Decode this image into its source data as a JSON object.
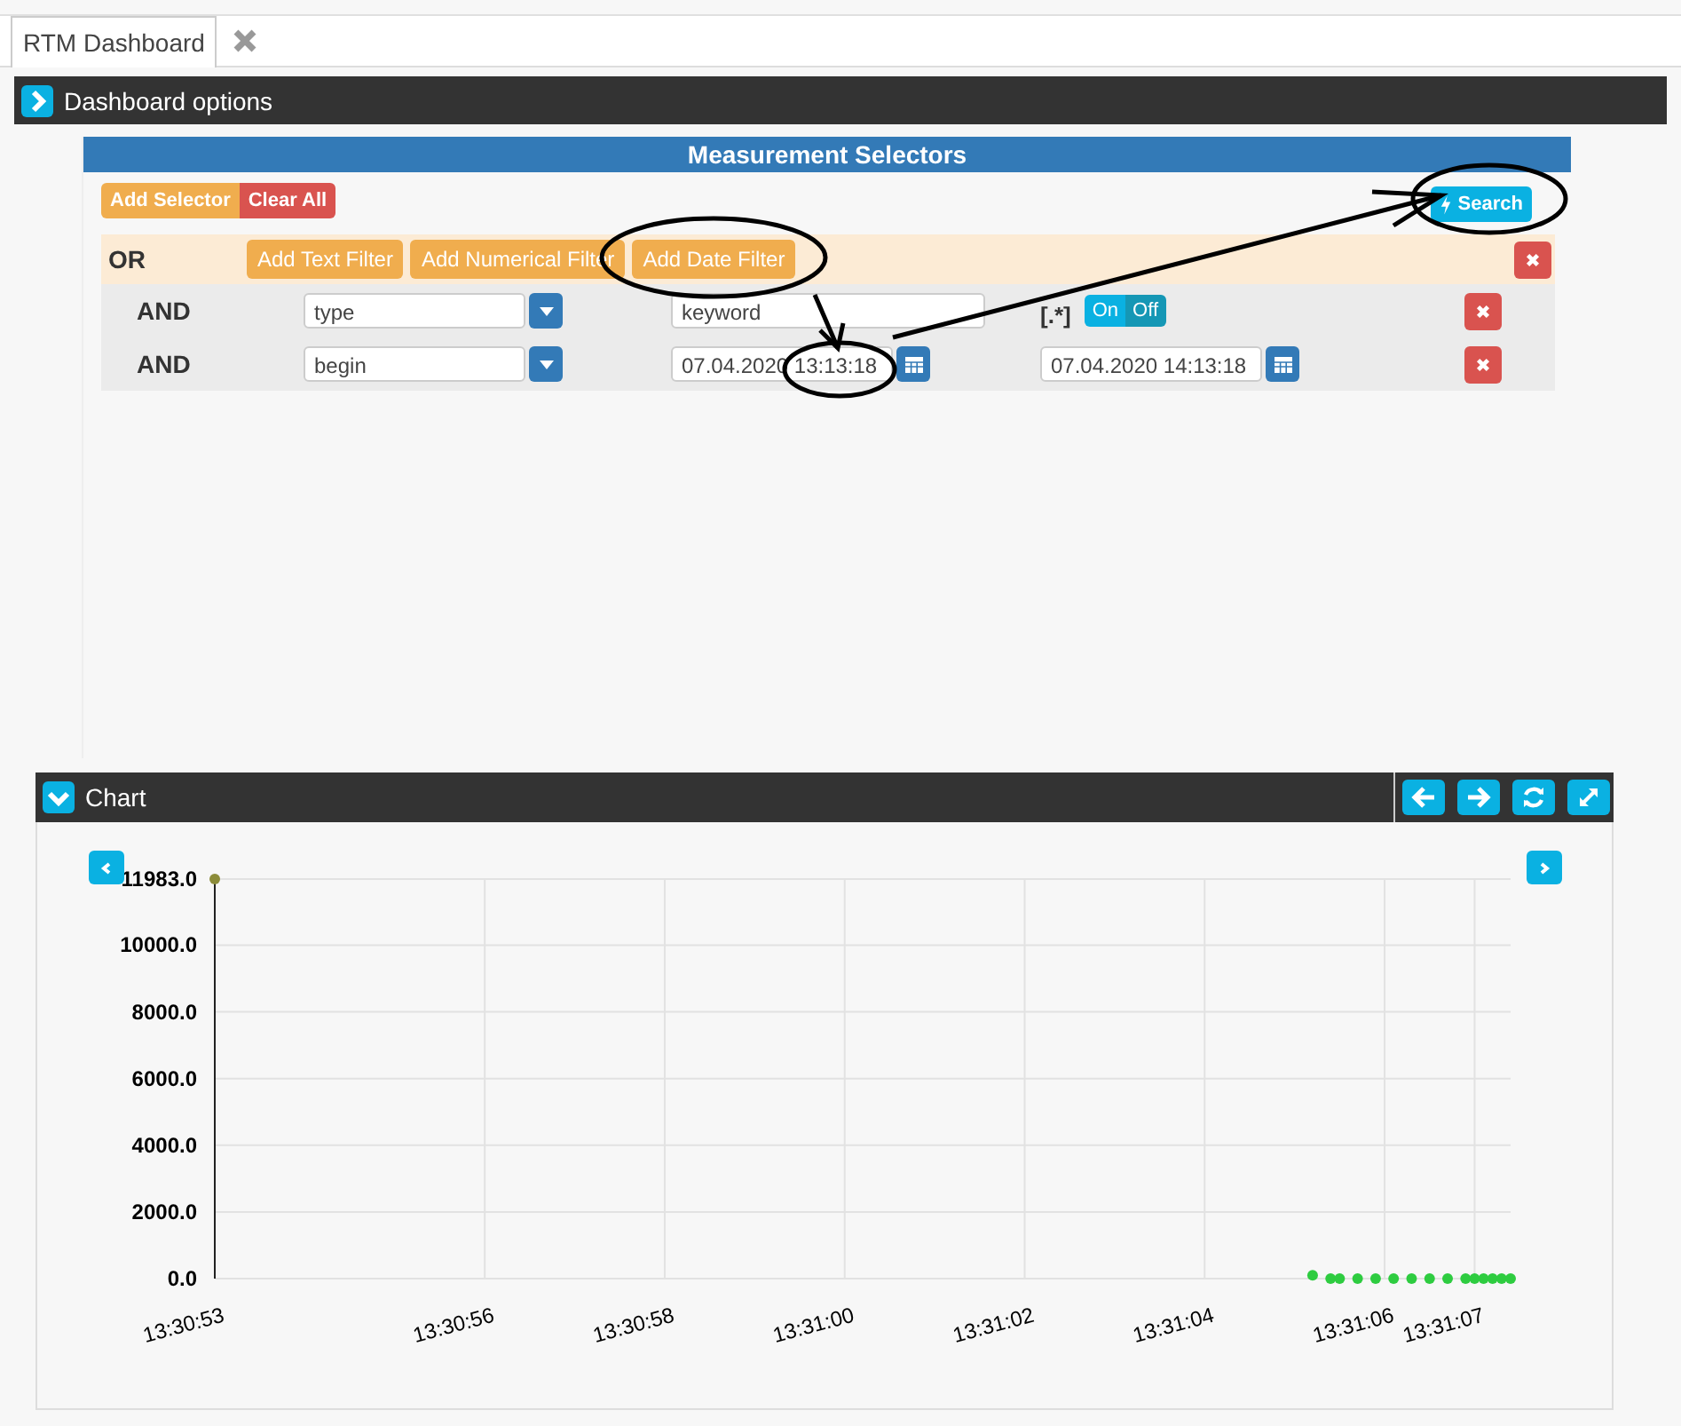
{
  "tabs": [
    {
      "label": "RTM Dashboard",
      "selected": true
    }
  ],
  "options_panel": {
    "title": "Dashboard options",
    "expanded": false
  },
  "selectors": {
    "title": "Measurement Selectors",
    "add_button": "Add Selector",
    "clear_button": "Clear All",
    "search_button": "Search",
    "group": {
      "operator": "OR",
      "buttons": [
        "Add Text Filter",
        "Add Numerical Filter",
        "Add Date Filter"
      ],
      "filters": [
        {
          "kind": "text",
          "operator": "AND",
          "field": "type",
          "value": "keyword",
          "regex_label": "[.*]",
          "toggle_on": "On",
          "toggle_off": "Off",
          "on": true
        },
        {
          "kind": "date",
          "operator": "AND",
          "field": "begin",
          "from": "07.04.2020 13:13:18",
          "to": "07.04.2020 14:13:18"
        }
      ]
    }
  },
  "markup": [
    {
      "kind": "circle"
    },
    {
      "kind": "circle"
    },
    {
      "kind": "circle"
    },
    {
      "kind": "arrow"
    },
    {
      "kind": "arrow"
    }
  ],
  "chart_panel": {
    "title": "Chart",
    "expanded": true,
    "chart_data": {
      "type": "scatter",
      "grid": true,
      "xlim": [
        48653,
        48667.4
      ],
      "ylim": [
        0,
        11983
      ],
      "xticks": [
        {
          "value": 48653,
          "label": "13:30:53"
        },
        {
          "value": 48656,
          "label": "13:30:56"
        },
        {
          "value": 48658,
          "label": "13:30:58"
        },
        {
          "value": 48660,
          "label": "13:31:00"
        },
        {
          "value": 48662,
          "label": "13:31:02"
        },
        {
          "value": 48664,
          "label": "13:31:04"
        },
        {
          "value": 48666,
          "label": "13:31:06"
        },
        {
          "value": 48667,
          "label": "13:31:07"
        }
      ],
      "yticks": [
        {
          "value": 0,
          "label": "0.0"
        },
        {
          "value": 2000,
          "label": "2000.0"
        },
        {
          "value": 4000,
          "label": "4000.0"
        },
        {
          "value": 6000,
          "label": "6000.0"
        },
        {
          "value": 8000,
          "label": "8000.0"
        },
        {
          "value": 10000,
          "label": "10000.0"
        },
        {
          "value": 11983,
          "label": "11983.0"
        }
      ],
      "series": [
        {
          "color": "#8c8c3a",
          "x": [
            48653
          ],
          "values": [
            11983
          ]
        },
        {
          "color": "#2ecc40",
          "x": [
            48665.2,
            48665.4,
            48665.5,
            48665.7,
            48665.9,
            48666.1,
            48666.3,
            48666.5,
            48666.7,
            48666.9,
            48667.0,
            48667.1,
            48667.2,
            48667.3,
            48667.4
          ],
          "values": [
            100,
            0,
            0,
            0,
            0,
            0,
            0,
            0,
            0,
            0,
            0,
            0,
            0,
            0,
            0
          ]
        }
      ]
    }
  }
}
